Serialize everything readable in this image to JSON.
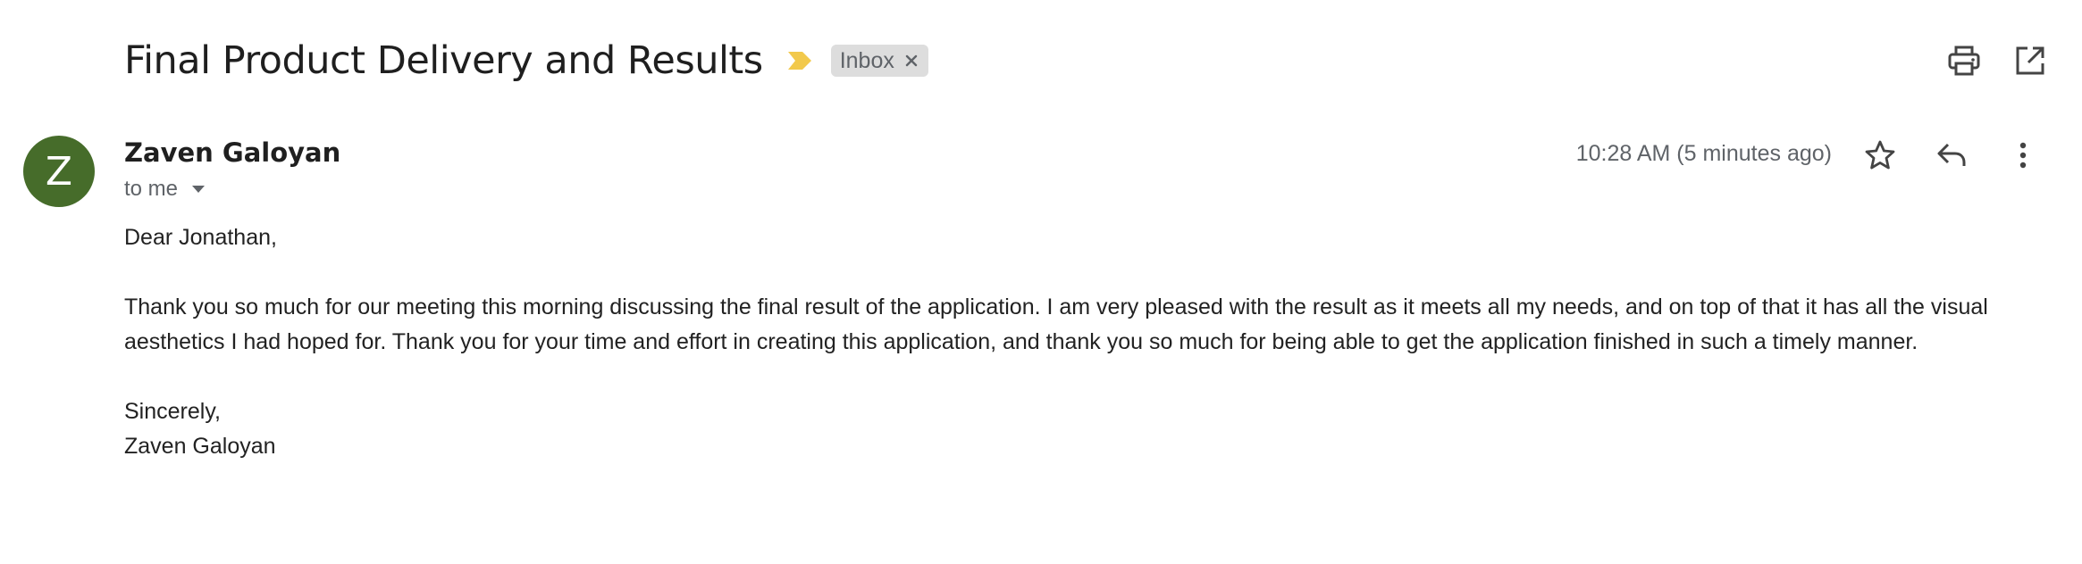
{
  "email": {
    "subject": "Final Product Delivery and Results",
    "label": "Inbox",
    "sender_initial": "Z",
    "sender_name": "Zaven Galoyan",
    "recipient": "to me",
    "timestamp": "10:28 AM (5 minutes ago)",
    "greeting": "Dear Jonathan,",
    "paragraph": "Thank you so much for our meeting this morning discussing the final result of the application. I am very pleased with the result as it meets all my needs, and on top of that it has all the visual aesthetics I had hoped for. Thank you for your time and effort in creating this application, and thank you so much for being able to get the application finished in such a timely manner.",
    "closing": "Sincerely,",
    "signature": "Zaven Galoyan"
  },
  "icons": {
    "importance": "importance-marker-icon",
    "label_remove": "close-icon",
    "print": "print-icon",
    "open_new_window": "open-in-new-window-icon",
    "recipient_details": "caret-down-icon",
    "star": "star-icon",
    "reply": "reply-icon",
    "more": "more-vertical-icon"
  },
  "colors": {
    "avatar_bg": "#466c2a",
    "importance": "#f2c94c",
    "label_bg": "#dddddd"
  }
}
